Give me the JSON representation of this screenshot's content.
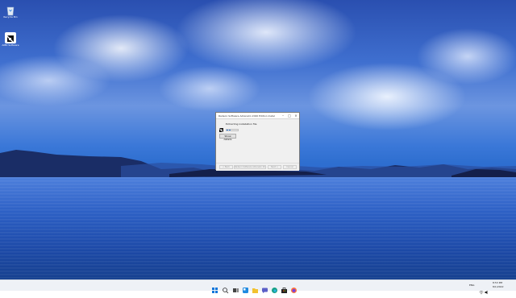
{
  "desktop": {
    "icons": [
      {
        "label": "Recycle Bin",
        "icon": "recycle-bin-icon"
      },
      {
        "label": "AMD Software",
        "icon": "amd-app-icon"
      }
    ]
  },
  "installer": {
    "title": "Radeon Software Adrenalin 2020 Edition Install",
    "status": "Extracting installation file",
    "show_details_label": "Show details",
    "progress": 0.35,
    "footer_buttons": {
      "back": "< Back",
      "middle": "Radeon Software Adrenalin 2020 Edition",
      "next": "Next >",
      "cancel": "Cancel"
    },
    "accent": "#2b7de0"
  },
  "taskbar": {
    "icons": [
      "start-icon",
      "search-icon",
      "task-view-icon",
      "widgets-icon",
      "file-explorer-icon",
      "chat-icon",
      "edge-icon",
      "store-icon",
      "firefox-icon"
    ],
    "tray": {
      "language": "ENG",
      "time": "8:53 PM",
      "date": "8/1/2022"
    }
  }
}
